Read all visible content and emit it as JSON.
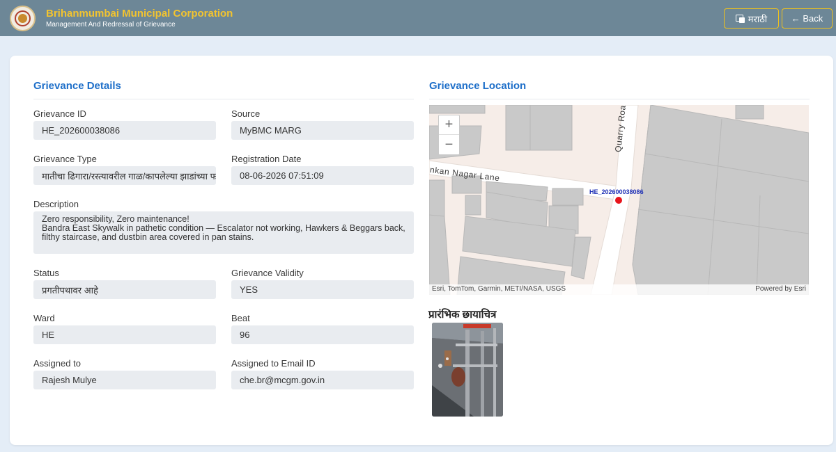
{
  "header": {
    "title": "Brihanmumbai Municipal Corporation",
    "subtitle": "Management And Redressal of Grievance",
    "language_button": "मराठी",
    "back_button": "← Back"
  },
  "details": {
    "heading": "Grievance Details",
    "fields": {
      "grievance_id": {
        "label": "Grievance ID",
        "value": "HE_202600038086"
      },
      "source": {
        "label": "Source",
        "value": "MyBMC MARG"
      },
      "grievance_type": {
        "label": "Grievance Type",
        "value": "मातीचा ढिगारा/रस्त्यावरील गाळ/कापलेल्या झाडांच्या फांद्या"
      },
      "registration_date": {
        "label": "Registration Date",
        "value": "08-06-2026 07:51:09"
      },
      "description": {
        "label": "Description",
        "value": "Zero responsibility, Zero maintenance!\nBandra East Skywalk in pathetic condition — Escalator not working, Hawkers & Beggars back, filthy staircase, and dustbin area covered in pan stains."
      },
      "status": {
        "label": "Status",
        "value": "प्रगतीपथावर आहे"
      },
      "validity": {
        "label": "Grievance Validity",
        "value": "YES"
      },
      "ward": {
        "label": "Ward",
        "value": "HE"
      },
      "beat": {
        "label": "Beat",
        "value": "96"
      },
      "assigned_to": {
        "label": "Assigned to",
        "value": "Rajesh Mulye"
      },
      "assigned_email": {
        "label": "Assigned to Email ID",
        "value": "che.br@mcgm.gov.in"
      }
    }
  },
  "location": {
    "heading": "Grievance Location",
    "zoom_in": "+",
    "zoom_out": "−",
    "marker_label": "HE_202600038086",
    "road_1": "nkan Nagar Lane",
    "road_2": "Quarry Roa",
    "attribution": "Esri, TomTom, Garmin, METI/NASA, USGS",
    "powered_by": "Powered by Esri"
  },
  "photos": {
    "heading": "प्रारंभिक छायाचित्र"
  },
  "colors": {
    "header_bg": "#6d8797",
    "brand_yellow": "#f3c42f",
    "accent_blue": "#1e6fc9",
    "marker_red": "#e8141b",
    "page_bg": "#e4edf7"
  }
}
